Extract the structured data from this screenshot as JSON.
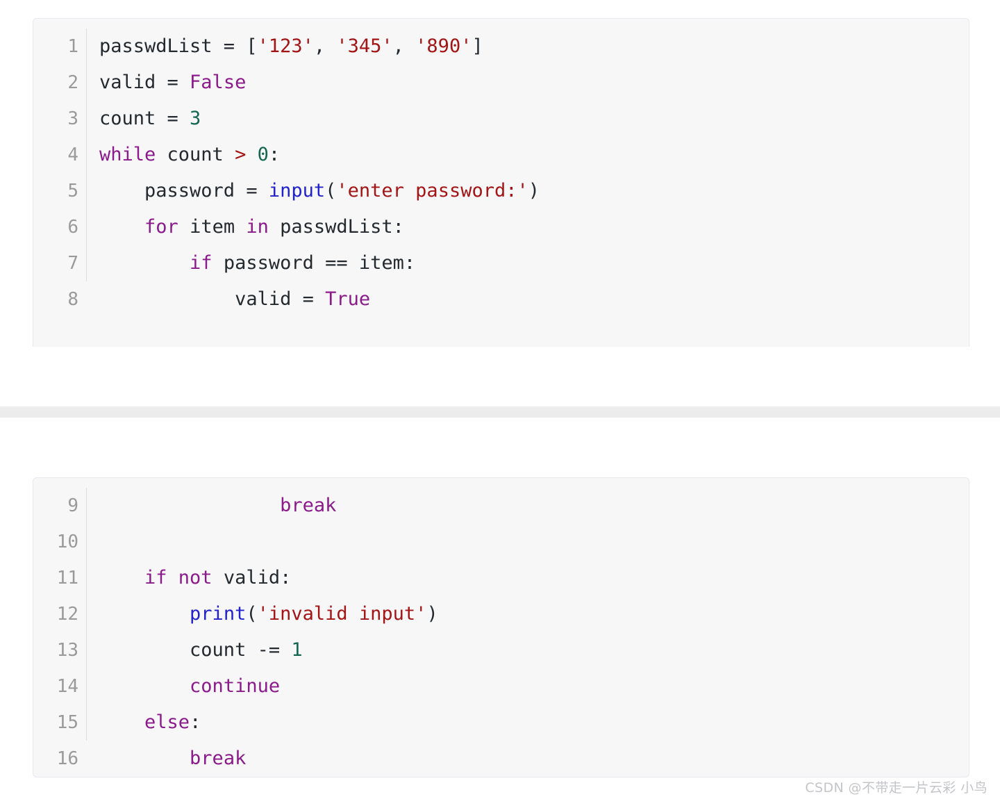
{
  "page": {
    "kind": "code-screenshot",
    "language": "python",
    "background_color": "#ffffff",
    "separator_band_color": "#ececec"
  },
  "theme": {
    "block_background": "#f7f7f8",
    "block_border": "#e6e9ed",
    "gutter_text": "#9a9a9a",
    "rail": "#dcdee0",
    "default_text": "#24292e",
    "keyword": "#8b1a8b",
    "string": "#a31515",
    "number": "#15664f",
    "builtin_function": "#2222cc",
    "operator": "#a31515",
    "watermark": "#c3c5c8"
  },
  "blocks": [
    {
      "id": "block-1",
      "name": "code-block-upper",
      "first_line": 1,
      "lines": [
        {
          "n": "1",
          "text": "passwdList = ['123', '345', '890']",
          "tokens": [
            {
              "t": "passwdList = [",
              "c": "pl"
            },
            {
              "t": "'123'",
              "c": "str"
            },
            {
              "t": ", ",
              "c": "pl"
            },
            {
              "t": "'345'",
              "c": "str"
            },
            {
              "t": ", ",
              "c": "pl"
            },
            {
              "t": "'890'",
              "c": "str"
            },
            {
              "t": "]",
              "c": "pl"
            }
          ]
        },
        {
          "n": "2",
          "text": "valid = False",
          "tokens": [
            {
              "t": "valid = ",
              "c": "pl"
            },
            {
              "t": "False",
              "c": "kw"
            }
          ]
        },
        {
          "n": "3",
          "text": "count = 3",
          "tokens": [
            {
              "t": "count = ",
              "c": "pl"
            },
            {
              "t": "3",
              "c": "num"
            }
          ]
        },
        {
          "n": "4",
          "text": "while count > 0:",
          "tokens": [
            {
              "t": "while",
              "c": "kw"
            },
            {
              "t": " count ",
              "c": "pl"
            },
            {
              "t": ">",
              "c": "op"
            },
            {
              "t": " ",
              "c": "pl"
            },
            {
              "t": "0",
              "c": "num"
            },
            {
              "t": ":",
              "c": "pl"
            }
          ]
        },
        {
          "n": "5",
          "text": "    password = input('enter password:')",
          "tokens": [
            {
              "t": "    password = ",
              "c": "pl"
            },
            {
              "t": "input",
              "c": "fn"
            },
            {
              "t": "(",
              "c": "pl"
            },
            {
              "t": "'enter password:'",
              "c": "str"
            },
            {
              "t": ")",
              "c": "pl"
            }
          ]
        },
        {
          "n": "6",
          "text": "    for item in passwdList:",
          "tokens": [
            {
              "t": "    ",
              "c": "pl"
            },
            {
              "t": "for",
              "c": "kw"
            },
            {
              "t": " item ",
              "c": "pl"
            },
            {
              "t": "in",
              "c": "kw"
            },
            {
              "t": " passwdList:",
              "c": "pl"
            }
          ]
        },
        {
          "n": "7",
          "text": "        if password == item:",
          "tokens": [
            {
              "t": "        ",
              "c": "pl"
            },
            {
              "t": "if",
              "c": "kw"
            },
            {
              "t": " password == item:",
              "c": "pl"
            }
          ]
        },
        {
          "n": "8",
          "text": "            valid = True",
          "tokens": [
            {
              "t": "            valid = ",
              "c": "pl"
            },
            {
              "t": "True",
              "c": "kw"
            }
          ]
        }
      ]
    },
    {
      "id": "block-2",
      "name": "code-block-lower",
      "first_line": 9,
      "lines": [
        {
          "n": "9",
          "text": "                break",
          "tokens": [
            {
              "t": "                ",
              "c": "pl"
            },
            {
              "t": "break",
              "c": "kw"
            }
          ]
        },
        {
          "n": "10",
          "text": "",
          "tokens": [
            {
              "t": "",
              "c": "pl"
            }
          ]
        },
        {
          "n": "11",
          "text": "    if not valid:",
          "tokens": [
            {
              "t": "    ",
              "c": "pl"
            },
            {
              "t": "if not",
              "c": "kw"
            },
            {
              "t": " valid:",
              "c": "pl"
            }
          ]
        },
        {
          "n": "12",
          "text": "        print('invalid input')",
          "tokens": [
            {
              "t": "        ",
              "c": "pl"
            },
            {
              "t": "print",
              "c": "fn"
            },
            {
              "t": "(",
              "c": "pl"
            },
            {
              "t": "'invalid input'",
              "c": "str"
            },
            {
              "t": ")",
              "c": "pl"
            }
          ]
        },
        {
          "n": "13",
          "text": "        count -= 1",
          "tokens": [
            {
              "t": "        count -= ",
              "c": "pl"
            },
            {
              "t": "1",
              "c": "num"
            }
          ]
        },
        {
          "n": "14",
          "text": "        continue",
          "tokens": [
            {
              "t": "        ",
              "c": "pl"
            },
            {
              "t": "continue",
              "c": "kw"
            }
          ]
        },
        {
          "n": "15",
          "text": "    else:",
          "tokens": [
            {
              "t": "    ",
              "c": "pl"
            },
            {
              "t": "else",
              "c": "kw"
            },
            {
              "t": ":",
              "c": "pl"
            }
          ]
        },
        {
          "n": "16",
          "text": "        break",
          "tokens": [
            {
              "t": "        ",
              "c": "pl"
            },
            {
              "t": "break",
              "c": "kw"
            }
          ]
        }
      ]
    }
  ],
  "watermark": {
    "text": "CSDN @不带走一片云彩 小鸟"
  }
}
